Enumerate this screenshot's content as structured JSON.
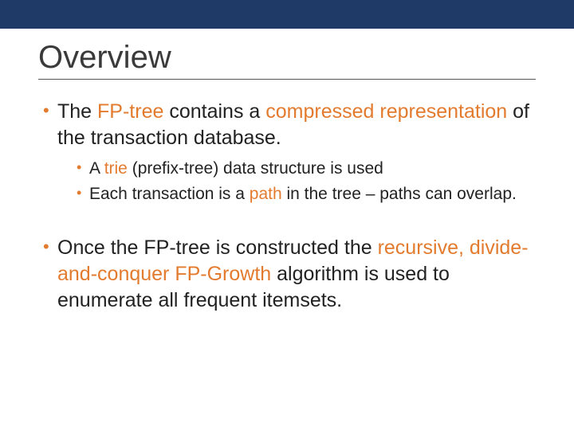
{
  "colors": {
    "topbar": "#1f3a66",
    "accent": "#e37b2f",
    "text": "#222222"
  },
  "title": "Overview",
  "bullets": {
    "b1": {
      "t1": "The ",
      "h1": "FP-tree",
      "t2": " contains a ",
      "h2": "compressed representation",
      "t3": " of the transaction database."
    },
    "b1_sub": {
      "s1": {
        "t1": "A ",
        "h1": "trie",
        "t2": " (prefix-tree) data structure is used"
      },
      "s2": {
        "t1": "Each transaction is a ",
        "h1": "path",
        "t2": " in the tree – paths can overlap."
      }
    },
    "b2": {
      "t1": "Once the FP-tree is constructed the ",
      "h1": "recursive, divide-and-conquer FP-Growth",
      "t2": " algorithm is used to enumerate all frequent itemsets."
    }
  }
}
